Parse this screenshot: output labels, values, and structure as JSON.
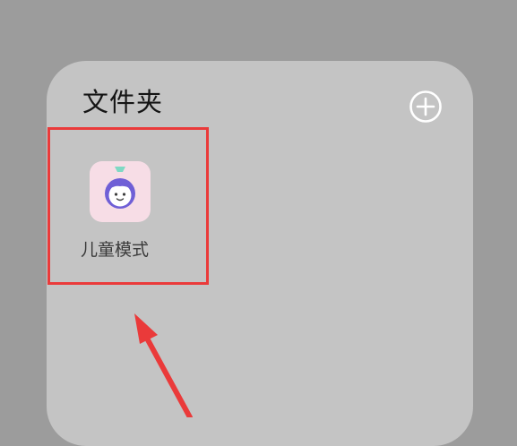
{
  "folder": {
    "title": "文件夹",
    "add_icon": "plus-circle-icon",
    "background_color": "#c4c4c4"
  },
  "apps": [
    {
      "label": "儿童模式",
      "icon": "kids-mode-icon",
      "icon_background": "#f7dde6",
      "icon_accent": "#6f5fd6",
      "icon_top_accent": "#7fd9c4"
    }
  ],
  "annotations": {
    "highlight_color": "#ea3a3a",
    "arrow_color": "#ea3a3a"
  }
}
